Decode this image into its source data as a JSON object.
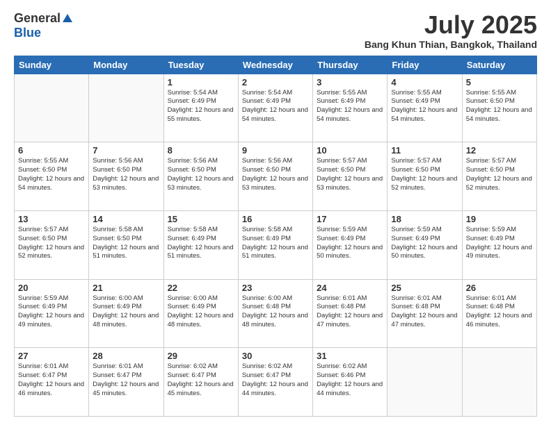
{
  "header": {
    "logo_general": "General",
    "logo_blue": "Blue",
    "month_title": "July 2025",
    "location": "Bang Khun Thian, Bangkok, Thailand"
  },
  "weekdays": [
    "Sunday",
    "Monday",
    "Tuesday",
    "Wednesday",
    "Thursday",
    "Friday",
    "Saturday"
  ],
  "weeks": [
    [
      {
        "day": "",
        "sunrise": "",
        "sunset": "",
        "daylight": ""
      },
      {
        "day": "",
        "sunrise": "",
        "sunset": "",
        "daylight": ""
      },
      {
        "day": "1",
        "sunrise": "Sunrise: 5:54 AM",
        "sunset": "Sunset: 6:49 PM",
        "daylight": "Daylight: 12 hours and 55 minutes."
      },
      {
        "day": "2",
        "sunrise": "Sunrise: 5:54 AM",
        "sunset": "Sunset: 6:49 PM",
        "daylight": "Daylight: 12 hours and 54 minutes."
      },
      {
        "day": "3",
        "sunrise": "Sunrise: 5:55 AM",
        "sunset": "Sunset: 6:49 PM",
        "daylight": "Daylight: 12 hours and 54 minutes."
      },
      {
        "day": "4",
        "sunrise": "Sunrise: 5:55 AM",
        "sunset": "Sunset: 6:49 PM",
        "daylight": "Daylight: 12 hours and 54 minutes."
      },
      {
        "day": "5",
        "sunrise": "Sunrise: 5:55 AM",
        "sunset": "Sunset: 6:50 PM",
        "daylight": "Daylight: 12 hours and 54 minutes."
      }
    ],
    [
      {
        "day": "6",
        "sunrise": "Sunrise: 5:55 AM",
        "sunset": "Sunset: 6:50 PM",
        "daylight": "Daylight: 12 hours and 54 minutes."
      },
      {
        "day": "7",
        "sunrise": "Sunrise: 5:56 AM",
        "sunset": "Sunset: 6:50 PM",
        "daylight": "Daylight: 12 hours and 53 minutes."
      },
      {
        "day": "8",
        "sunrise": "Sunrise: 5:56 AM",
        "sunset": "Sunset: 6:50 PM",
        "daylight": "Daylight: 12 hours and 53 minutes."
      },
      {
        "day": "9",
        "sunrise": "Sunrise: 5:56 AM",
        "sunset": "Sunset: 6:50 PM",
        "daylight": "Daylight: 12 hours and 53 minutes."
      },
      {
        "day": "10",
        "sunrise": "Sunrise: 5:57 AM",
        "sunset": "Sunset: 6:50 PM",
        "daylight": "Daylight: 12 hours and 53 minutes."
      },
      {
        "day": "11",
        "sunrise": "Sunrise: 5:57 AM",
        "sunset": "Sunset: 6:50 PM",
        "daylight": "Daylight: 12 hours and 52 minutes."
      },
      {
        "day": "12",
        "sunrise": "Sunrise: 5:57 AM",
        "sunset": "Sunset: 6:50 PM",
        "daylight": "Daylight: 12 hours and 52 minutes."
      }
    ],
    [
      {
        "day": "13",
        "sunrise": "Sunrise: 5:57 AM",
        "sunset": "Sunset: 6:50 PM",
        "daylight": "Daylight: 12 hours and 52 minutes."
      },
      {
        "day": "14",
        "sunrise": "Sunrise: 5:58 AM",
        "sunset": "Sunset: 6:50 PM",
        "daylight": "Daylight: 12 hours and 51 minutes."
      },
      {
        "day": "15",
        "sunrise": "Sunrise: 5:58 AM",
        "sunset": "Sunset: 6:49 PM",
        "daylight": "Daylight: 12 hours and 51 minutes."
      },
      {
        "day": "16",
        "sunrise": "Sunrise: 5:58 AM",
        "sunset": "Sunset: 6:49 PM",
        "daylight": "Daylight: 12 hours and 51 minutes."
      },
      {
        "day": "17",
        "sunrise": "Sunrise: 5:59 AM",
        "sunset": "Sunset: 6:49 PM",
        "daylight": "Daylight: 12 hours and 50 minutes."
      },
      {
        "day": "18",
        "sunrise": "Sunrise: 5:59 AM",
        "sunset": "Sunset: 6:49 PM",
        "daylight": "Daylight: 12 hours and 50 minutes."
      },
      {
        "day": "19",
        "sunrise": "Sunrise: 5:59 AM",
        "sunset": "Sunset: 6:49 PM",
        "daylight": "Daylight: 12 hours and 49 minutes."
      }
    ],
    [
      {
        "day": "20",
        "sunrise": "Sunrise: 5:59 AM",
        "sunset": "Sunset: 6:49 PM",
        "daylight": "Daylight: 12 hours and 49 minutes."
      },
      {
        "day": "21",
        "sunrise": "Sunrise: 6:00 AM",
        "sunset": "Sunset: 6:49 PM",
        "daylight": "Daylight: 12 hours and 48 minutes."
      },
      {
        "day": "22",
        "sunrise": "Sunrise: 6:00 AM",
        "sunset": "Sunset: 6:49 PM",
        "daylight": "Daylight: 12 hours and 48 minutes."
      },
      {
        "day": "23",
        "sunrise": "Sunrise: 6:00 AM",
        "sunset": "Sunset: 6:48 PM",
        "daylight": "Daylight: 12 hours and 48 minutes."
      },
      {
        "day": "24",
        "sunrise": "Sunrise: 6:01 AM",
        "sunset": "Sunset: 6:48 PM",
        "daylight": "Daylight: 12 hours and 47 minutes."
      },
      {
        "day": "25",
        "sunrise": "Sunrise: 6:01 AM",
        "sunset": "Sunset: 6:48 PM",
        "daylight": "Daylight: 12 hours and 47 minutes."
      },
      {
        "day": "26",
        "sunrise": "Sunrise: 6:01 AM",
        "sunset": "Sunset: 6:48 PM",
        "daylight": "Daylight: 12 hours and 46 minutes."
      }
    ],
    [
      {
        "day": "27",
        "sunrise": "Sunrise: 6:01 AM",
        "sunset": "Sunset: 6:47 PM",
        "daylight": "Daylight: 12 hours and 46 minutes."
      },
      {
        "day": "28",
        "sunrise": "Sunrise: 6:01 AM",
        "sunset": "Sunset: 6:47 PM",
        "daylight": "Daylight: 12 hours and 45 minutes."
      },
      {
        "day": "29",
        "sunrise": "Sunrise: 6:02 AM",
        "sunset": "Sunset: 6:47 PM",
        "daylight": "Daylight: 12 hours and 45 minutes."
      },
      {
        "day": "30",
        "sunrise": "Sunrise: 6:02 AM",
        "sunset": "Sunset: 6:47 PM",
        "daylight": "Daylight: 12 hours and 44 minutes."
      },
      {
        "day": "31",
        "sunrise": "Sunrise: 6:02 AM",
        "sunset": "Sunset: 6:46 PM",
        "daylight": "Daylight: 12 hours and 44 minutes."
      },
      {
        "day": "",
        "sunrise": "",
        "sunset": "",
        "daylight": ""
      },
      {
        "day": "",
        "sunrise": "",
        "sunset": "",
        "daylight": ""
      }
    ]
  ]
}
